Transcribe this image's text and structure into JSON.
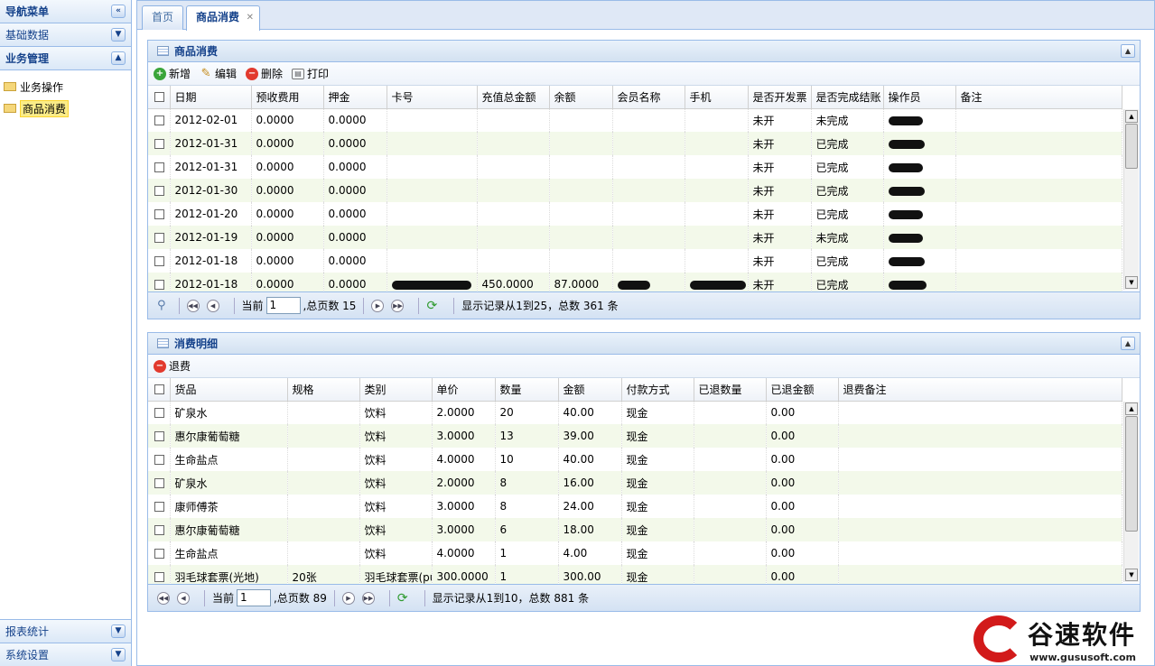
{
  "sidebar": {
    "title": "导航菜单",
    "collapse_icon": "double-chevron-left-icon",
    "sections": [
      "基础数据",
      "业务管理"
    ],
    "tree": [
      "业务操作",
      "商品消费"
    ],
    "bottom_sections": [
      "报表统计",
      "系统设置"
    ]
  },
  "tabs": [
    {
      "label": "首页"
    },
    {
      "label": "商品消费",
      "close": "✕"
    }
  ],
  "consumption": {
    "title": "商品消费",
    "toolbar": {
      "add": "新增",
      "edit": "编辑",
      "delete": "删除",
      "print": "打印"
    },
    "columns": [
      "日期",
      "预收费用",
      "押金",
      "卡号",
      "充值总金额",
      "余额",
      "会员名称",
      "手机",
      "是否开发票",
      "是否完成结账",
      "操作员",
      "备注"
    ],
    "rows": [
      [
        "2012-02-01",
        "0.0000",
        "0.0000",
        "",
        "",
        "",
        "",
        "",
        "未开",
        "未完成"
      ],
      [
        "2012-01-31",
        "0.0000",
        "0.0000",
        "",
        "",
        "",
        "",
        "",
        "未开",
        "已完成"
      ],
      [
        "2012-01-31",
        "0.0000",
        "0.0000",
        "",
        "",
        "",
        "",
        "",
        "未开",
        "已完成"
      ],
      [
        "2012-01-30",
        "0.0000",
        "0.0000",
        "",
        "",
        "",
        "",
        "",
        "未开",
        "已完成"
      ],
      [
        "2012-01-20",
        "0.0000",
        "0.0000",
        "",
        "",
        "",
        "",
        "",
        "未开",
        "已完成"
      ],
      [
        "2012-01-19",
        "0.0000",
        "0.0000",
        "",
        "",
        "",
        "",
        "",
        "未开",
        "未完成"
      ],
      [
        "2012-01-18",
        "0.0000",
        "0.0000",
        "",
        "",
        "",
        "",
        "",
        "未开",
        "已完成"
      ],
      [
        "2012-01-18",
        "0.0000",
        "0.0000",
        "",
        "450.0000",
        "87.0000",
        "",
        "",
        "未开",
        "已完成"
      ]
    ],
    "pager": {
      "current_label": "当前",
      "current_value": "1",
      "total_pages": ",总页数 15",
      "summary": "显示记录从1到25，总数 361 条"
    }
  },
  "details": {
    "title": "消费明细",
    "toolbar": {
      "refund": "退费"
    },
    "columns": [
      "货品",
      "规格",
      "类别",
      "单价",
      "数量",
      "金额",
      "付款方式",
      "已退数量",
      "已退金额",
      "退费备注"
    ],
    "rows": [
      [
        "矿泉水",
        "",
        "饮料",
        "2.0000",
        "20",
        "40.00",
        "现金",
        "",
        "0.00",
        ""
      ],
      [
        "惠尔康葡萄糖",
        "",
        "饮料",
        "3.0000",
        "13",
        "39.00",
        "现金",
        "",
        "0.00",
        ""
      ],
      [
        "生命盐点",
        "",
        "饮料",
        "4.0000",
        "10",
        "40.00",
        "现金",
        "",
        "0.00",
        ""
      ],
      [
        "矿泉水",
        "",
        "饮料",
        "2.0000",
        "8",
        "16.00",
        "现金",
        "",
        "0.00",
        ""
      ],
      [
        "康师傅茶",
        "",
        "饮料",
        "3.0000",
        "8",
        "24.00",
        "现金",
        "",
        "0.00",
        ""
      ],
      [
        "惠尔康葡萄糖",
        "",
        "饮料",
        "3.0000",
        "6",
        "18.00",
        "现金",
        "",
        "0.00",
        ""
      ],
      [
        "生命盐点",
        "",
        "饮料",
        "4.0000",
        "1",
        "4.00",
        "现金",
        "",
        "0.00",
        ""
      ],
      [
        "羽毛球套票(光地)",
        "20张",
        "羽毛球套票(pu",
        "300.0000",
        "1",
        "300.00",
        "现金",
        "",
        "0.00",
        ""
      ]
    ],
    "pager": {
      "current_label": "当前",
      "current_value": "1",
      "total_pages": ",总页数 89",
      "summary": "显示记录从1到10，总数 881 条"
    }
  },
  "logo": {
    "brand": "谷速软件",
    "url": "www.gususoft.com",
    "color": "#d21a1a"
  }
}
